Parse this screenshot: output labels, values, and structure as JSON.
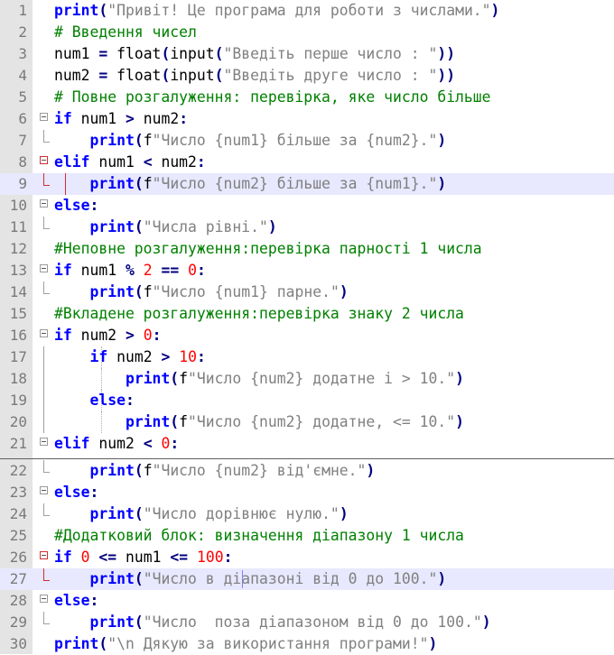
{
  "editor": {
    "line_numbers": [
      "1",
      "2",
      "3",
      "4",
      "5",
      "6",
      "7",
      "8",
      "9",
      "10",
      "11",
      "12",
      "13",
      "14",
      "15",
      "16",
      "17",
      "18",
      "19",
      "20",
      "21",
      "22",
      "23",
      "24",
      "25",
      "26",
      "27",
      "28",
      "29",
      "30"
    ],
    "lines": [
      [
        [
          "kw",
          "print"
        ],
        [
          "op",
          "("
        ],
        [
          "str",
          "\"Привіт! Це програма для роботи з числами.\""
        ],
        [
          "op",
          ")"
        ]
      ],
      [
        [
          "cmt",
          "# Введення чисел"
        ]
      ],
      [
        [
          "id",
          "num1 "
        ],
        [
          "op",
          "="
        ],
        [
          "id",
          " float"
        ],
        [
          "op",
          "("
        ],
        [
          "id",
          "input"
        ],
        [
          "op",
          "("
        ],
        [
          "str",
          "\"Введіть перше число : \""
        ],
        [
          "op",
          "))"
        ]
      ],
      [
        [
          "id",
          "num2 "
        ],
        [
          "op",
          "="
        ],
        [
          "id",
          " float"
        ],
        [
          "op",
          "("
        ],
        [
          "id",
          "input"
        ],
        [
          "op",
          "("
        ],
        [
          "str",
          "\"Введіть друге число : \""
        ],
        [
          "op",
          "))"
        ]
      ],
      [
        [
          "cmt",
          "# Повне розгалуження: перевірка, яке число більше"
        ]
      ],
      [
        [
          "kw",
          "if"
        ],
        [
          "id",
          " num1 "
        ],
        [
          "op",
          ">"
        ],
        [
          "id",
          " num2"
        ],
        [
          "op",
          ":"
        ]
      ],
      [
        [
          "id",
          "    "
        ],
        [
          "kw",
          "print"
        ],
        [
          "op",
          "("
        ],
        [
          "id",
          "f"
        ],
        [
          "str",
          "\"Число {num1} більше за {num2}.\""
        ],
        [
          "op",
          ")"
        ]
      ],
      [
        [
          "kw",
          "elif"
        ],
        [
          "id",
          " num1 "
        ],
        [
          "op",
          "<"
        ],
        [
          "id",
          " num2"
        ],
        [
          "op",
          ":"
        ]
      ],
      [
        [
          "id",
          "    "
        ],
        [
          "kw",
          "print"
        ],
        [
          "op",
          "("
        ],
        [
          "id",
          "f"
        ],
        [
          "str",
          "\"Число {num2} більше за {num1}.\""
        ],
        [
          "op",
          ")"
        ]
      ],
      [
        [
          "kw",
          "else"
        ],
        [
          "op",
          ":"
        ]
      ],
      [
        [
          "id",
          "    "
        ],
        [
          "kw",
          "print"
        ],
        [
          "op",
          "("
        ],
        [
          "str",
          "\"Числа рівні.\""
        ],
        [
          "op",
          ")"
        ]
      ],
      [
        [
          "cmt",
          "#Неповне розгалуження:перевірка парності 1 числа"
        ]
      ],
      [
        [
          "kw",
          "if"
        ],
        [
          "id",
          " num1 "
        ],
        [
          "op",
          "%"
        ],
        [
          "id",
          " "
        ],
        [
          "num",
          "2"
        ],
        [
          "id",
          " "
        ],
        [
          "op",
          "=="
        ],
        [
          "id",
          " "
        ],
        [
          "num",
          "0"
        ],
        [
          "op",
          ":"
        ]
      ],
      [
        [
          "id",
          "    "
        ],
        [
          "kw",
          "print"
        ],
        [
          "op",
          "("
        ],
        [
          "id",
          "f"
        ],
        [
          "str",
          "\"Число {num1} парне.\""
        ],
        [
          "op",
          ")"
        ]
      ],
      [
        [
          "cmt",
          "#Вкладене розгалуження:перевірка знаку 2 числа"
        ]
      ],
      [
        [
          "kw",
          "if"
        ],
        [
          "id",
          " num2 "
        ],
        [
          "op",
          ">"
        ],
        [
          "id",
          " "
        ],
        [
          "num",
          "0"
        ],
        [
          "op",
          ":"
        ]
      ],
      [
        [
          "id",
          "    "
        ],
        [
          "kw",
          "if"
        ],
        [
          "id",
          " num2 "
        ],
        [
          "op",
          ">"
        ],
        [
          "id",
          " "
        ],
        [
          "num",
          "10"
        ],
        [
          "op",
          ":"
        ]
      ],
      [
        [
          "id",
          "        "
        ],
        [
          "kw",
          "print"
        ],
        [
          "op",
          "("
        ],
        [
          "id",
          "f"
        ],
        [
          "str",
          "\"Число {num2} додатне і > 10.\""
        ],
        [
          "op",
          ")"
        ]
      ],
      [
        [
          "id",
          "    "
        ],
        [
          "kw",
          "else"
        ],
        [
          "op",
          ":"
        ]
      ],
      [
        [
          "id",
          "        "
        ],
        [
          "kw",
          "print"
        ],
        [
          "op",
          "("
        ],
        [
          "id",
          "f"
        ],
        [
          "str",
          "\"Число {num2} додатне, <= 10.\""
        ],
        [
          "op",
          ")"
        ]
      ],
      [
        [
          "kw",
          "elif"
        ],
        [
          "id",
          " num2 "
        ],
        [
          "op",
          "<"
        ],
        [
          "id",
          " "
        ],
        [
          "num",
          "0"
        ],
        [
          "op",
          ":"
        ]
      ],
      [
        [
          "id",
          "    "
        ],
        [
          "kw",
          "print"
        ],
        [
          "op",
          "("
        ],
        [
          "id",
          "f"
        ],
        [
          "str",
          "\"Число {num2} від'ємне.\""
        ],
        [
          "op",
          ")"
        ]
      ],
      [
        [
          "kw",
          "else"
        ],
        [
          "op",
          ":"
        ]
      ],
      [
        [
          "id",
          "    "
        ],
        [
          "kw",
          "print"
        ],
        [
          "op",
          "("
        ],
        [
          "str",
          "\"Число дорівнює нулю.\""
        ],
        [
          "op",
          ")"
        ]
      ],
      [
        [
          "cmt",
          "#Додатковий блок: визначення діапазону 1 числа"
        ]
      ],
      [
        [
          "kw",
          "if"
        ],
        [
          "id",
          " "
        ],
        [
          "num",
          "0"
        ],
        [
          "id",
          " "
        ],
        [
          "op",
          "<="
        ],
        [
          "id",
          " num1 "
        ],
        [
          "op",
          "<="
        ],
        [
          "id",
          " "
        ],
        [
          "num",
          "100"
        ],
        [
          "op",
          ":"
        ]
      ],
      [
        [
          "id",
          "    "
        ],
        [
          "kw",
          "print"
        ],
        [
          "op",
          "("
        ],
        [
          "str",
          "\"Число в діапазоні від 0 до 100.\""
        ],
        [
          "op",
          ")"
        ]
      ],
      [
        [
          "kw",
          "else"
        ],
        [
          "op",
          ":"
        ]
      ],
      [
        [
          "id",
          "    "
        ],
        [
          "kw",
          "print"
        ],
        [
          "op",
          "("
        ],
        [
          "str",
          "\"Число  поза діапазоном від 0 до 100.\""
        ],
        [
          "op",
          ")"
        ]
      ],
      [
        [
          "kw",
          "print"
        ],
        [
          "op",
          "("
        ],
        [
          "str",
          "\"\\n Дякую за використання програми!\""
        ],
        [
          "op",
          ")"
        ]
      ]
    ]
  },
  "colors": {
    "keyword": "#0000ff",
    "operator": "#000080",
    "string": "#808080",
    "number": "#ff0000",
    "comment": "#008000",
    "gutter": "#e4e4e4",
    "current_line": "#e8e8ff",
    "fold_marker_active": "#d03030"
  }
}
